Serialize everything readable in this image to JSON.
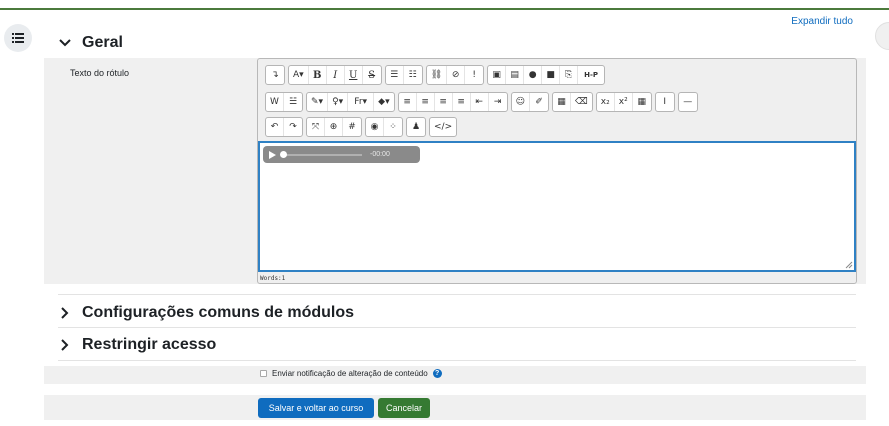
{
  "header": {
    "expand_all": "Expandir tudo"
  },
  "sections": {
    "general": {
      "title": "Geral"
    },
    "common_modules": {
      "title": "Configurações comuns de módulos"
    },
    "restrict": {
      "title": "Restringir acesso"
    }
  },
  "form": {
    "field_label": "Texto do rótulo",
    "notify_label": "Enviar notificação de alteração de conteúdo",
    "notify_checked": false,
    "save_label": "Salvar e voltar ao curso",
    "cancel_label": "Cancelar"
  },
  "editor": {
    "toolbar_row1": [
      {
        "name": "toolbar-collapse-button",
        "label": "↴"
      },
      {
        "name": "font-size-button",
        "label": "A▾"
      },
      {
        "name": "bold-button",
        "label": "B"
      },
      {
        "name": "italic-button",
        "label": "I"
      },
      {
        "name": "underline-button",
        "label": "U"
      },
      {
        "name": "strikethrough-button",
        "label": "S"
      },
      {
        "name": "bullet-list-button",
        "label": "☰"
      },
      {
        "name": "numbered-list-button",
        "label": "☷"
      },
      {
        "name": "link-button",
        "label": "⛓"
      },
      {
        "name": "unlink-button",
        "label": "⊘"
      },
      {
        "name": "autolink-button",
        "label": "!"
      },
      {
        "name": "image-button",
        "label": "▣"
      },
      {
        "name": "media-button",
        "label": "▤"
      },
      {
        "name": "record-audio-button",
        "label": "●"
      },
      {
        "name": "record-video-button",
        "label": "■"
      },
      {
        "name": "manage-files-button",
        "label": "⎘"
      },
      {
        "name": "h5p-button",
        "label": "H-P"
      }
    ],
    "toolbar_row2": [
      {
        "name": "word-import-button",
        "label": "W"
      },
      {
        "name": "multilang-button",
        "label": "☱"
      },
      {
        "name": "text-color-button",
        "label": "✎▾"
      },
      {
        "name": "highlight-button",
        "label": "♀▾"
      },
      {
        "name": "font-family-button",
        "label": "Fr▾"
      },
      {
        "name": "background-color-button",
        "label": "◆▾"
      },
      {
        "name": "align-left-button",
        "label": "≡"
      },
      {
        "name": "align-center-button",
        "label": "≡"
      },
      {
        "name": "align-right-button",
        "label": "≡"
      },
      {
        "name": "justify-button",
        "label": "≡"
      },
      {
        "name": "outdent-button",
        "label": "⇤"
      },
      {
        "name": "indent-button",
        "label": "⇥"
      },
      {
        "name": "emoji-button",
        "label": "☺"
      },
      {
        "name": "special-char-button",
        "label": "✐"
      },
      {
        "name": "table-button",
        "label": "▦"
      },
      {
        "name": "clear-format-button",
        "label": "⌫"
      },
      {
        "name": "subscript-button",
        "label": "x₂"
      },
      {
        "name": "superscript-button",
        "label": "x²"
      },
      {
        "name": "calculator-button",
        "label": "▦"
      },
      {
        "name": "cursor-button",
        "label": "I"
      },
      {
        "name": "horizontal-rule-button",
        "label": "—"
      }
    ],
    "toolbar_row3": [
      {
        "name": "undo-button",
        "label": "↶"
      },
      {
        "name": "redo-button",
        "label": "↷"
      },
      {
        "name": "fullscreen-button",
        "label": "⤧"
      },
      {
        "name": "search-replace-button",
        "label": "⊕"
      },
      {
        "name": "hashtag-button",
        "label": "#"
      },
      {
        "name": "accessibility-button",
        "label": "◉"
      },
      {
        "name": "screenreader-button",
        "label": "⁘"
      },
      {
        "name": "teams-button",
        "label": "♟"
      },
      {
        "name": "html-button",
        "label": "</>"
      }
    ],
    "audio_time": "-00:00",
    "word_count": "Words:1"
  },
  "colors": {
    "primary": "#0f6cbf",
    "success": "#357a32",
    "editor_focus": "#2f81c4"
  }
}
